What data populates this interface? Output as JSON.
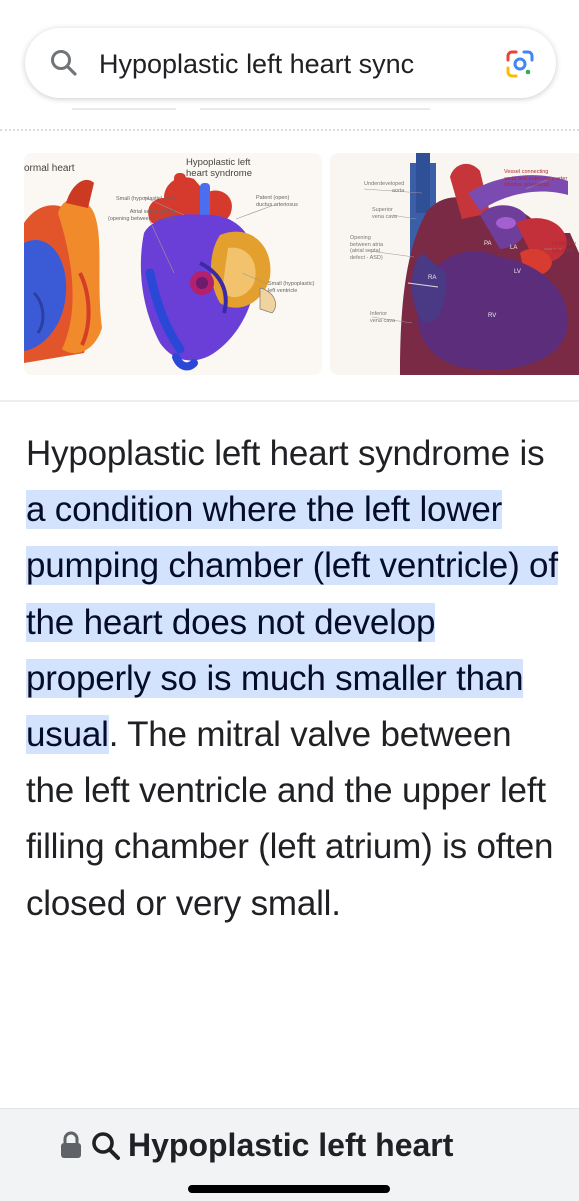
{
  "search": {
    "query": "Hypoplastic left heart sync",
    "icon": "search-icon",
    "lens_icon": "google-lens-icon"
  },
  "images": {
    "left": {
      "label_normal": "ormal heart",
      "label_hlhs_line1": "Hypoplastic left",
      "label_hlhs_line2": "heart syndrome",
      "callout_small_aorta": "Small (hypoplastic) aorta",
      "callout_asd_line1": "Atrial septal defect",
      "callout_asd_line2": "(opening between the atria)",
      "callout_patent_line1": "Patent (open)",
      "callout_patent_line2": "ductus arteriosus",
      "callout_small_lv_line1": "Small (hypoplastic)",
      "callout_small_lv_line2": "left ventricle"
    },
    "right": {
      "underdeveloped_aorta_line1": "Underdeveloped",
      "underdeveloped_aorta_line2": "aorta",
      "vessel_line1": "Vessel connecting",
      "vessel_line2": "aorta and pulmonary arter",
      "vessel_line3": "(ductus arteriosus)",
      "svc_line1": "Superior",
      "svc_line2": "vena cava",
      "opening_line1": "Opening",
      "opening_line2": "between atria",
      "opening_line3": "(atrial septal",
      "opening_line4": "defect - ASD)",
      "ivc_line1": "Inferior",
      "ivc_line2": "vena cava",
      "underdev_right_line1": "Underdev",
      "underdev_right_line2": "left ventr",
      "pa": "PA",
      "la": "LA",
      "ra": "RA",
      "lv": "LV",
      "rv": "RV"
    }
  },
  "answer": {
    "intro": "Hypoplastic left heart syndrome is ",
    "highlight": "a condition where the left lower pumping chamber (left ventricle) of the heart does not develop properly so is much smaller than usual",
    "after": ". The mitral valve between the left ventricle and the upper left filling chamber (left atrium) is often closed or very small."
  },
  "bottom_bar": {
    "lock_icon": "lock-icon",
    "search_icon": "search-icon",
    "title": "Hypoplastic left heart"
  }
}
